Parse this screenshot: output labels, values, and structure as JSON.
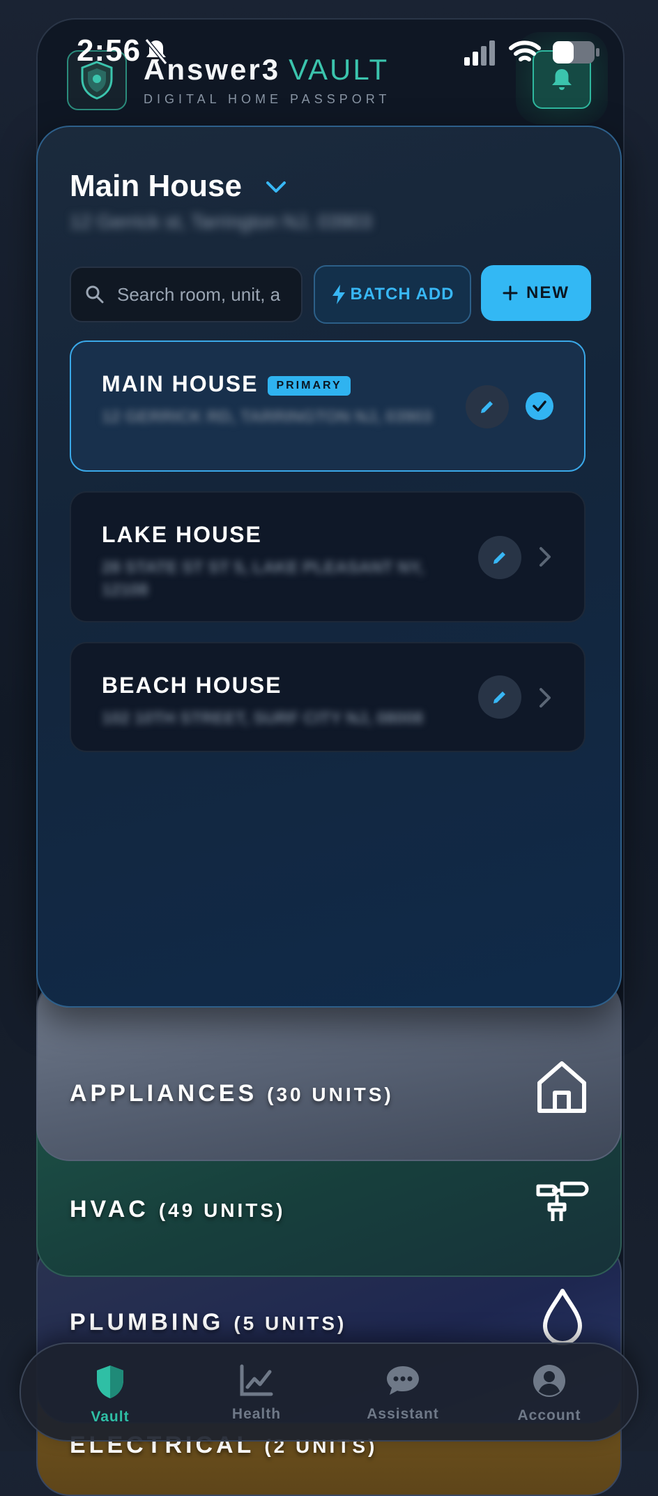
{
  "status_bar": {
    "time": "2:56"
  },
  "header": {
    "brand_name": "Answer3",
    "brand_accent": "VAULT",
    "subtitle": "DIGITAL HOME PASSPORT"
  },
  "house_selector": {
    "title": "Main House",
    "address": "12 Gerrick st, Tarrington NJ, 03903"
  },
  "toolbar": {
    "search_placeholder": "Search room, unit, a",
    "batch_add_label": "BATCH ADD",
    "new_label": "NEW"
  },
  "properties": [
    {
      "name": "MAIN HOUSE",
      "badge": "PRIMARY",
      "address": "12 GERRICK RD, TARRINGTON NJ, 03903",
      "selected": true
    },
    {
      "name": "LAKE HOUSE",
      "address": "28 STATE ST ST 5, LAKE PLEASANT NY, 12108",
      "selected": false
    },
    {
      "name": "BEACH HOUSE",
      "address": "102 10TH STREET, SURF CITY NJ, 08008",
      "selected": false
    }
  ],
  "categories": [
    {
      "name": "APPLIANCES",
      "units": "(30 UNITS)",
      "icon": "home-icon"
    },
    {
      "name": "HVAC",
      "units": "(49 UNITS)",
      "icon": "fan-icon"
    },
    {
      "name": "PLUMBING",
      "units": "(5 UNITS)",
      "icon": "water-drop-icon"
    },
    {
      "name": "ELECTRICAL",
      "units": "(2 UNITS)",
      "icon": "plug-icon"
    }
  ],
  "bottom_nav": [
    {
      "label": "Vault",
      "icon": "shield-icon",
      "active": true
    },
    {
      "label": "Health",
      "icon": "chart-icon",
      "active": false
    },
    {
      "label": "Assistant",
      "icon": "chat-icon",
      "active": false
    },
    {
      "label": "Account",
      "icon": "user-icon",
      "active": false
    }
  ],
  "colors": {
    "accent_teal": "#3bc4ad",
    "accent_blue": "#33b8f4",
    "card_bg": "#14253a",
    "appliances_bg": "#5d6778",
    "hvac_bg": "#173f3c",
    "plumbing_bg": "#222a4e",
    "electrical_bg": "#6e5420"
  }
}
